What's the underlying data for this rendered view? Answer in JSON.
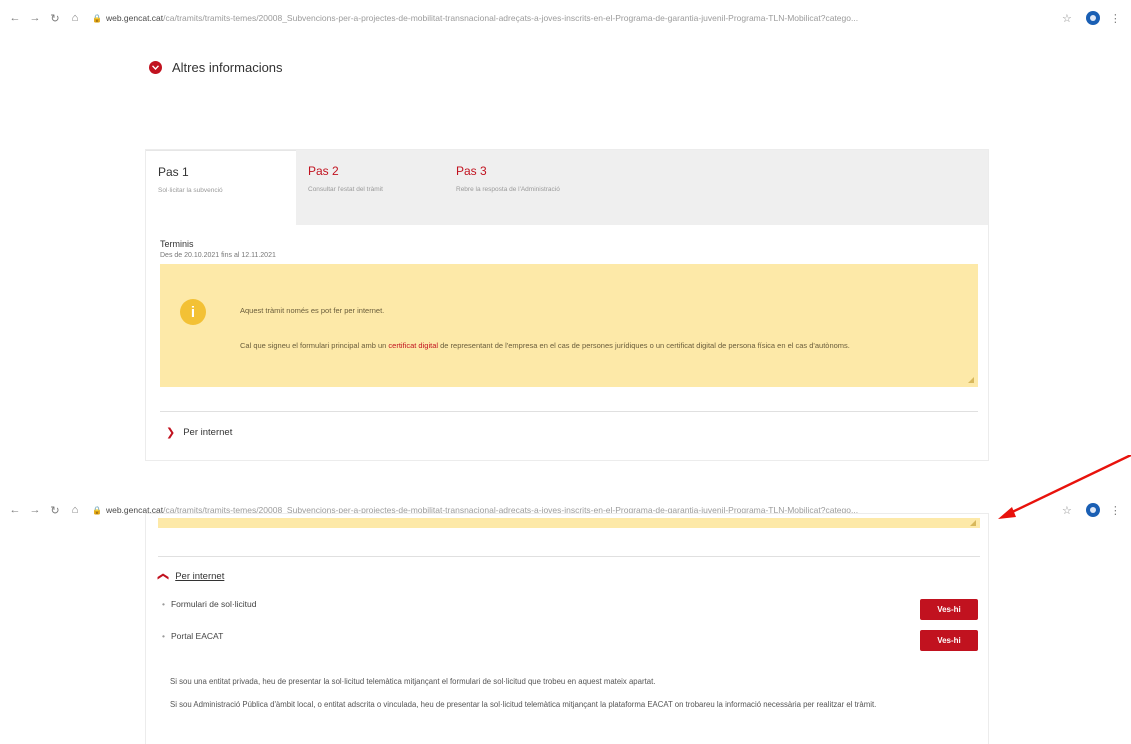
{
  "browser": {
    "url_domain": "web.gencat.cat",
    "url_path": "/ca/tramits/tramits-temes/20008_Subvencions-per-a-projectes-de-mobilitat-transnacional-adreçats-a-joves-inscrits-en-el-Programa-de-garantia-juvenil-Programa-TLN-Mobilicat?catego..."
  },
  "top": {
    "section_title": "Altres informacions",
    "tabs": [
      {
        "name": "Pas 1",
        "desc": "Sol·licitar la subvenció"
      },
      {
        "name": "Pas 2",
        "desc": "Consultar l'estat del tràmit"
      },
      {
        "name": "Pas 3",
        "desc": "Rebre la resposta de l'Administració"
      }
    ],
    "termini_title": "Terminis",
    "termini_value": "Des de 20.10.2021 fins al 12.11.2021",
    "info_line1": "Aquest tràmit només es pot fer per internet.",
    "info_line2_a": "Cal que signeu el formulari principal amb un ",
    "info_line2_link": "certificat digital",
    "info_line2_b": " de representant de l'empresa en el cas de persones jurídiques o un certificat digital de persona física en el cas d'autònoms.",
    "per_internet": "Per internet"
  },
  "bottom": {
    "per_internet": "Per internet",
    "items": [
      {
        "label": "Formulari de sol·licitud",
        "button": "Ves-hi"
      },
      {
        "label": "Portal EACAT",
        "button": "Ves-hi"
      }
    ],
    "para1": "Si sou una entitat privada, heu de presentar la sol·licitud telemàtica mitjançant el formulari de sol·licitud que trobeu en aquest mateix apartat.",
    "para2": "Si sou Administració Pública d'àmbit local, o entitat adscrita o vinculada, heu de presentar la sol·licitud telemàtica mitjançant la plataforma EACAT on trobareu la informació necessària per realitzar el tràmit."
  },
  "colors": {
    "accent": "#c1121f",
    "info_bg": "#fde9a8",
    "arrow": "#e8120c"
  },
  "icons": [
    "back-icon",
    "forward-icon",
    "reload-icon",
    "home-icon",
    "lock-icon",
    "star-icon",
    "profile-icon",
    "kebab-icon",
    "chevron-icon",
    "info-icon"
  ]
}
